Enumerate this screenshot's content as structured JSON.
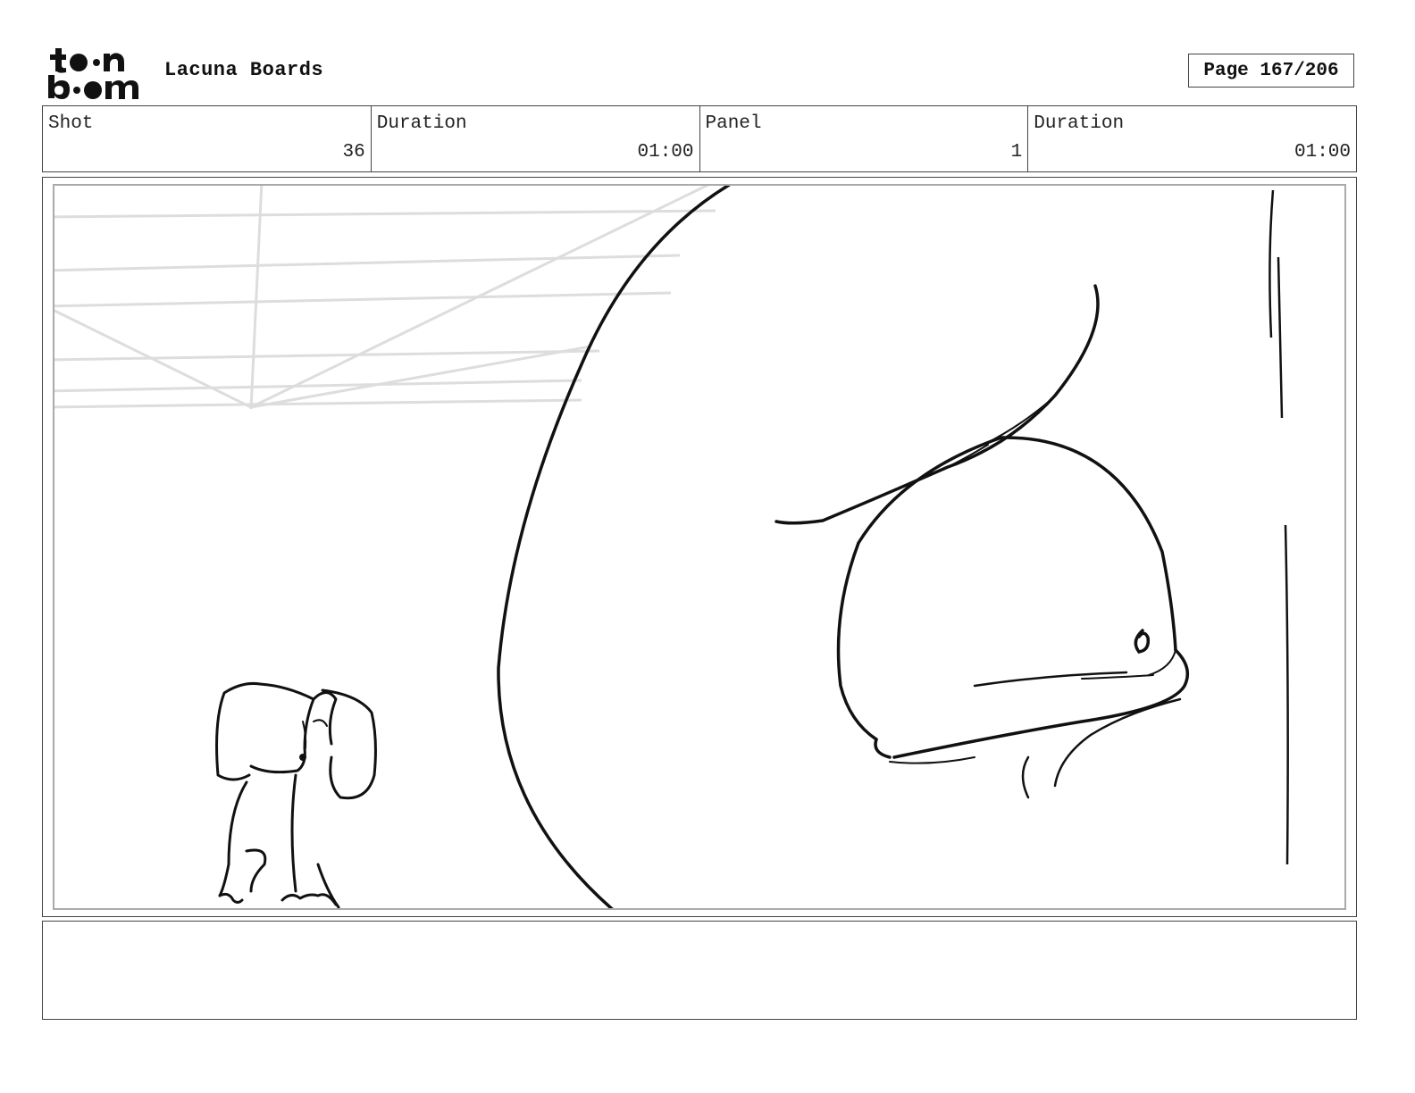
{
  "header": {
    "logo_alt": "toon boom",
    "project_title": "Lacuna Boards",
    "page_label": "Page 167/206"
  },
  "info": {
    "shot": {
      "label": "Shot",
      "value": "36"
    },
    "shot_duration": {
      "label": "Duration",
      "value": "01:00"
    },
    "panel": {
      "label": "Panel",
      "value": "1"
    },
    "panel_duration": {
      "label": "Duration",
      "value": "01:00"
    }
  },
  "notes": {
    "text": ""
  },
  "colors": {
    "ink": "#111111",
    "guide": "#dddddd",
    "border": "#444444"
  }
}
